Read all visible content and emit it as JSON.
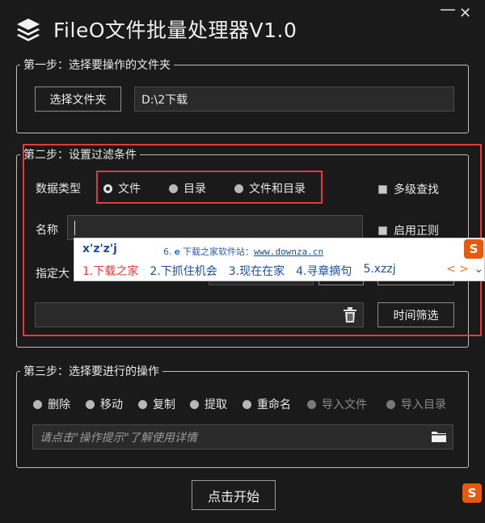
{
  "app": {
    "title": "FileO文件批量处理器V1.0",
    "minimize_icon": "minimize-icon",
    "close_icon": "close-icon"
  },
  "step1": {
    "legend": "第一步：选择要操作的文件夹",
    "select_button": "选择文件夹",
    "folder_path": "D:\\2下载"
  },
  "step2": {
    "legend": "第二步：设置过滤条件",
    "data_type_label": "数据类型",
    "data_types": [
      {
        "label": "文件",
        "selected": true
      },
      {
        "label": "目录",
        "selected": false
      },
      {
        "label": "文件和目录",
        "selected": false
      }
    ],
    "multi_level_label": "多级查找",
    "name_label": "名称",
    "regex_label": "启用正则",
    "size_label": "指定大",
    "time_filter_button": "时间筛选",
    "trash_icon": "trash-icon"
  },
  "step3": {
    "legend": "第三步：选择要进行的操作",
    "operations": [
      {
        "label": "删除",
        "enabled": true
      },
      {
        "label": "移动",
        "enabled": true
      },
      {
        "label": "复制",
        "enabled": true
      },
      {
        "label": "提取",
        "enabled": true
      },
      {
        "label": "重命名",
        "enabled": true
      },
      {
        "label": "导入文件",
        "enabled": false
      },
      {
        "label": "导入目录",
        "enabled": false
      }
    ],
    "hint_placeholder": "请点击\"操作提示\"了解使用详情",
    "folder_icon": "folder-icon"
  },
  "start_button": "点击开始",
  "ime": {
    "composition": "x'z'z'j",
    "hint_prefix": "6.",
    "hint_text": "下载之家软件站：",
    "hint_url": "www.downza.cn",
    "candidates": [
      "1.下载之家",
      "2.下抓住机会",
      "3.现在在家",
      "4.寻章摘句",
      "5.xzzj"
    ],
    "nav": "< >",
    "more": "⌄",
    "logo_letter": "S"
  },
  "colors": {
    "background": "#1a1a1a",
    "highlight": "#e53935",
    "ime_text": "#1a4fa0"
  }
}
